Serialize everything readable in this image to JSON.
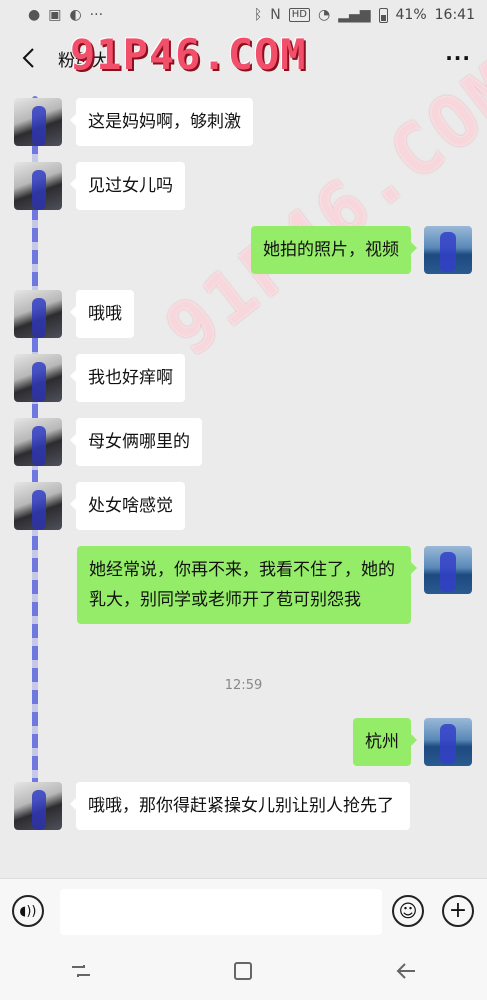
{
  "status_bar": {
    "battery": "41%",
    "time": "16:41",
    "hd": "HD",
    "icons": [
      "wechat-icon",
      "image-icon",
      "sync-icon",
      "more-dots-icon",
      "bluetooth-icon",
      "nfc-icon",
      "wifi-icon",
      "signal-icon",
      "battery-icon"
    ]
  },
  "header": {
    "back_icon": "chevron-left-icon",
    "title": "粉母大",
    "more_icon": "more-dots-icon"
  },
  "watermark": {
    "text": "91P46.COM"
  },
  "messages": [
    {
      "side": "in",
      "text": "这是妈妈啊，够刺激"
    },
    {
      "side": "in",
      "text": "见过女儿吗"
    },
    {
      "side": "out",
      "text": "她拍的照片，视频"
    },
    {
      "side": "in",
      "text": "哦哦"
    },
    {
      "side": "in",
      "text": "我也好痒啊"
    },
    {
      "side": "in",
      "text": "母女俩哪里的"
    },
    {
      "side": "in",
      "text": "处女啥感觉"
    },
    {
      "side": "out",
      "text": "她经常说，你再不来，我看不住了，她的乳大，别同学或老师开了苞可别怨我"
    },
    {
      "side": "out",
      "text": "杭州"
    },
    {
      "side": "in",
      "text": "哦哦，那你得赶紧操女儿别让别人抢先了"
    }
  ],
  "timestamp": "12:59",
  "input_bar": {
    "voice_icon": "voice-icon",
    "input_value": "",
    "emoji_icon": "emoji-icon",
    "plus_icon": "plus-icon"
  },
  "nav_bar": {
    "icons": [
      "back-nav-icon",
      "home-nav-icon",
      "recents-nav-icon"
    ]
  }
}
